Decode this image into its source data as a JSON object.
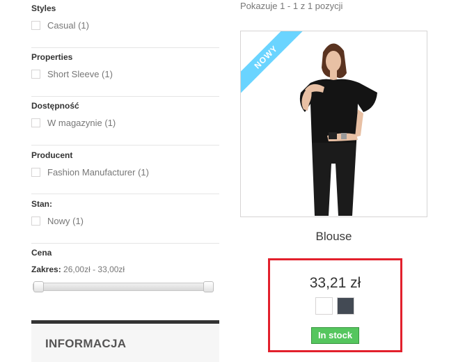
{
  "filters": [
    {
      "title": "Styles",
      "option": "Casual (1)"
    },
    {
      "title": "Properties",
      "option": "Short Sleeve (1)"
    },
    {
      "title": "Dostępność",
      "option": "W magazynie (1)"
    },
    {
      "title": "Producent",
      "option": "Fashion Manufacturer (1)"
    },
    {
      "title": "Stan:",
      "option": "Nowy (1)"
    }
  ],
  "price_filter": {
    "title": "Cena",
    "range_label": "Zakres:",
    "range_value": "26,00zł - 33,00zł"
  },
  "info_block": {
    "title": "INFORMACJA"
  },
  "results": {
    "count_text": "Pokazuje 1 - 1 z 1 pozycji"
  },
  "product": {
    "badge": "NOWY",
    "name": "Blouse",
    "price": "33,21 zł",
    "colors": [
      "#ffffff",
      "#434a54"
    ],
    "stock": "In stock"
  }
}
